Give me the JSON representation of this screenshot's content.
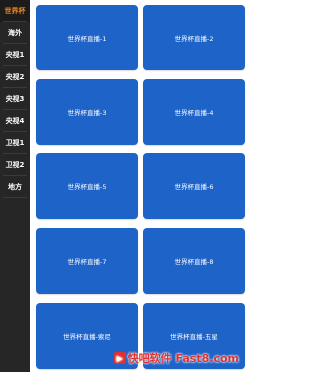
{
  "sidebar": {
    "items": [
      {
        "label": "世界杯",
        "active": true
      },
      {
        "label": "海外",
        "active": false
      },
      {
        "label": "央视1",
        "active": false
      },
      {
        "label": "央视2",
        "active": false
      },
      {
        "label": "央视3",
        "active": false
      },
      {
        "label": "央视4",
        "active": false
      },
      {
        "label": "卫视1",
        "active": false
      },
      {
        "label": "卫视2",
        "active": false
      },
      {
        "label": "地方",
        "active": false
      }
    ]
  },
  "channels": [
    {
      "label": "世界杯直播-1"
    },
    {
      "label": "世界杯直播-2"
    },
    {
      "label": "世界杯直播-3"
    },
    {
      "label": "世界杯直播-4"
    },
    {
      "label": "世界杯直播-5"
    },
    {
      "label": "世界杯直播-6"
    },
    {
      "label": "世界杯直播-7"
    },
    {
      "label": "世界杯直播-8"
    },
    {
      "label": "世界杯直播-索尼"
    },
    {
      "label": "世界杯直播-五星"
    }
  ],
  "colors": {
    "sidebar_bg": "#262626",
    "active_text": "#f08a1c",
    "tile_bg": "#1e63c8",
    "watermark": "#e03030"
  },
  "watermark": {
    "text": "快吧软件 Fast8.com",
    "icon": "logo-icon"
  }
}
